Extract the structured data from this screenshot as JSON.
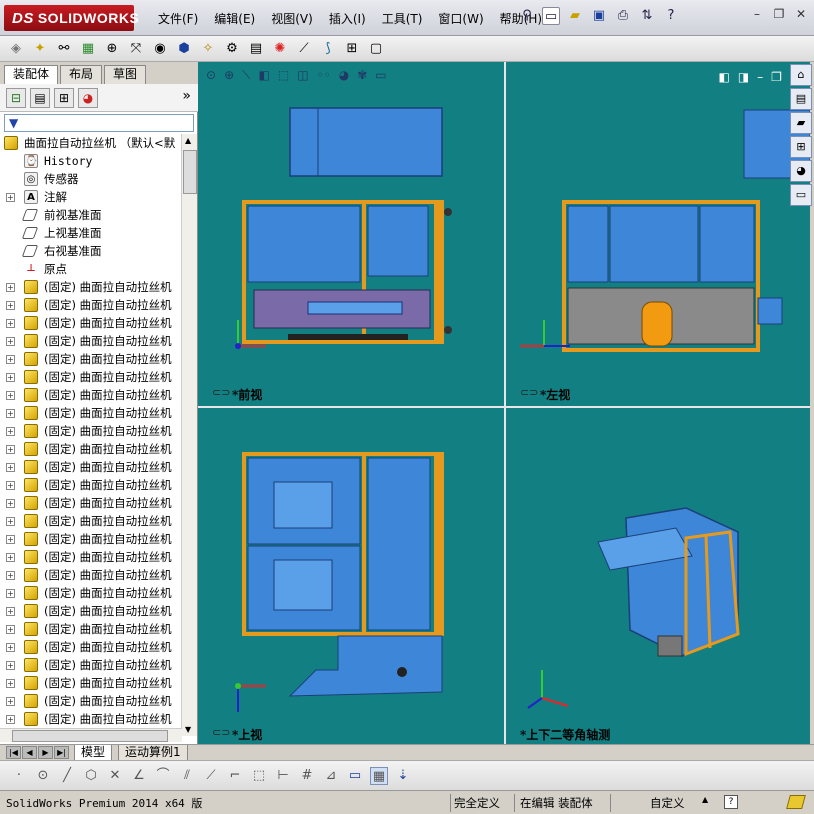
{
  "app": {
    "logo_text": "SOLIDWORKS",
    "logo_prefix": "DS"
  },
  "menu": [
    "文件(F)",
    "编辑(E)",
    "视图(V)",
    "插入(I)",
    "工具(T)",
    "窗口(W)",
    "帮助(H)"
  ],
  "panel": {
    "tabs": [
      "装配体",
      "布局",
      "草图"
    ],
    "active_tab": "装配体",
    "more": "»",
    "filter_icon": "filter-icon"
  },
  "tree": {
    "root": "曲面拉自动拉丝机  （默认<默",
    "items": [
      {
        "label": "History",
        "icon": "history-icon"
      },
      {
        "label": "传感器",
        "icon": "sensor-icon"
      },
      {
        "label": "注解",
        "icon": "annotation-icon"
      },
      {
        "label": "前视基准面",
        "icon": "plane-icon"
      },
      {
        "label": "上视基准面",
        "icon": "plane-icon"
      },
      {
        "label": "右视基准面",
        "icon": "plane-icon"
      },
      {
        "label": "原点",
        "icon": "origin-icon"
      }
    ],
    "component_label": "(固定) 曲面拉自动拉丝机"
  },
  "viewports": {
    "front": "*前视",
    "left": "*左视",
    "top": "*上视",
    "iso": "*上下二等角轴测"
  },
  "model_tabs": [
    "模型",
    "运动算例1"
  ],
  "status": {
    "version": "SolidWorks Premium 2014 x64 版",
    "defined": "完全定义",
    "editing": "在编辑 装配体",
    "custom": "自定义",
    "arrow": "▲"
  }
}
